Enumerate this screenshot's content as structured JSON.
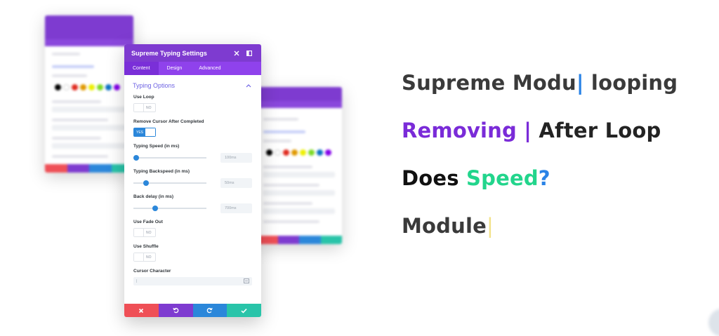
{
  "panel": {
    "title": "Supreme Typing Settings",
    "tabs": [
      "Content",
      "Design",
      "Advanced"
    ],
    "section_title": "Typing Options",
    "use_loop": {
      "label": "Use Loop",
      "state": "NO"
    },
    "remove_cursor": {
      "label": "Remove Cursor After Completed",
      "state": "YES"
    },
    "typing_speed": {
      "label": "Typing Speed (in ms)",
      "value": "100ms",
      "fraction": 0.04
    },
    "typing_backspeed": {
      "label": "Typing Backspeed (in ms)",
      "value": "50ms",
      "fraction": 0.17
    },
    "back_delay": {
      "label": "Back delay (in ms)",
      "value": "700ms",
      "fraction": 0.3
    },
    "fade_out": {
      "label": "Use Fade Out",
      "state": "NO"
    },
    "shuffle": {
      "label": "Use Shuffle",
      "state": "NO"
    },
    "cursor_char": {
      "label": "Cursor Character",
      "value": "|"
    }
  },
  "footer_colors": [
    "#ef4f56",
    "#7e3bd0",
    "#2b87da",
    "#29c4a9"
  ],
  "lines": {
    "l1_a": "Supreme Modu",
    "l1_cursor": "|",
    "l1_b": " looping",
    "l2_a": "Removing |",
    "l2_b": " After Loop",
    "l3_a": "Does ",
    "l3_b": "Speed",
    "l3_c": "?",
    "l4_a": "Module",
    "l4_cursor": "|"
  },
  "colors": {
    "accent_purple": "#7e3bd0",
    "blue": "#2b87da",
    "green": "#22d58c",
    "red": "#ef4f56"
  }
}
